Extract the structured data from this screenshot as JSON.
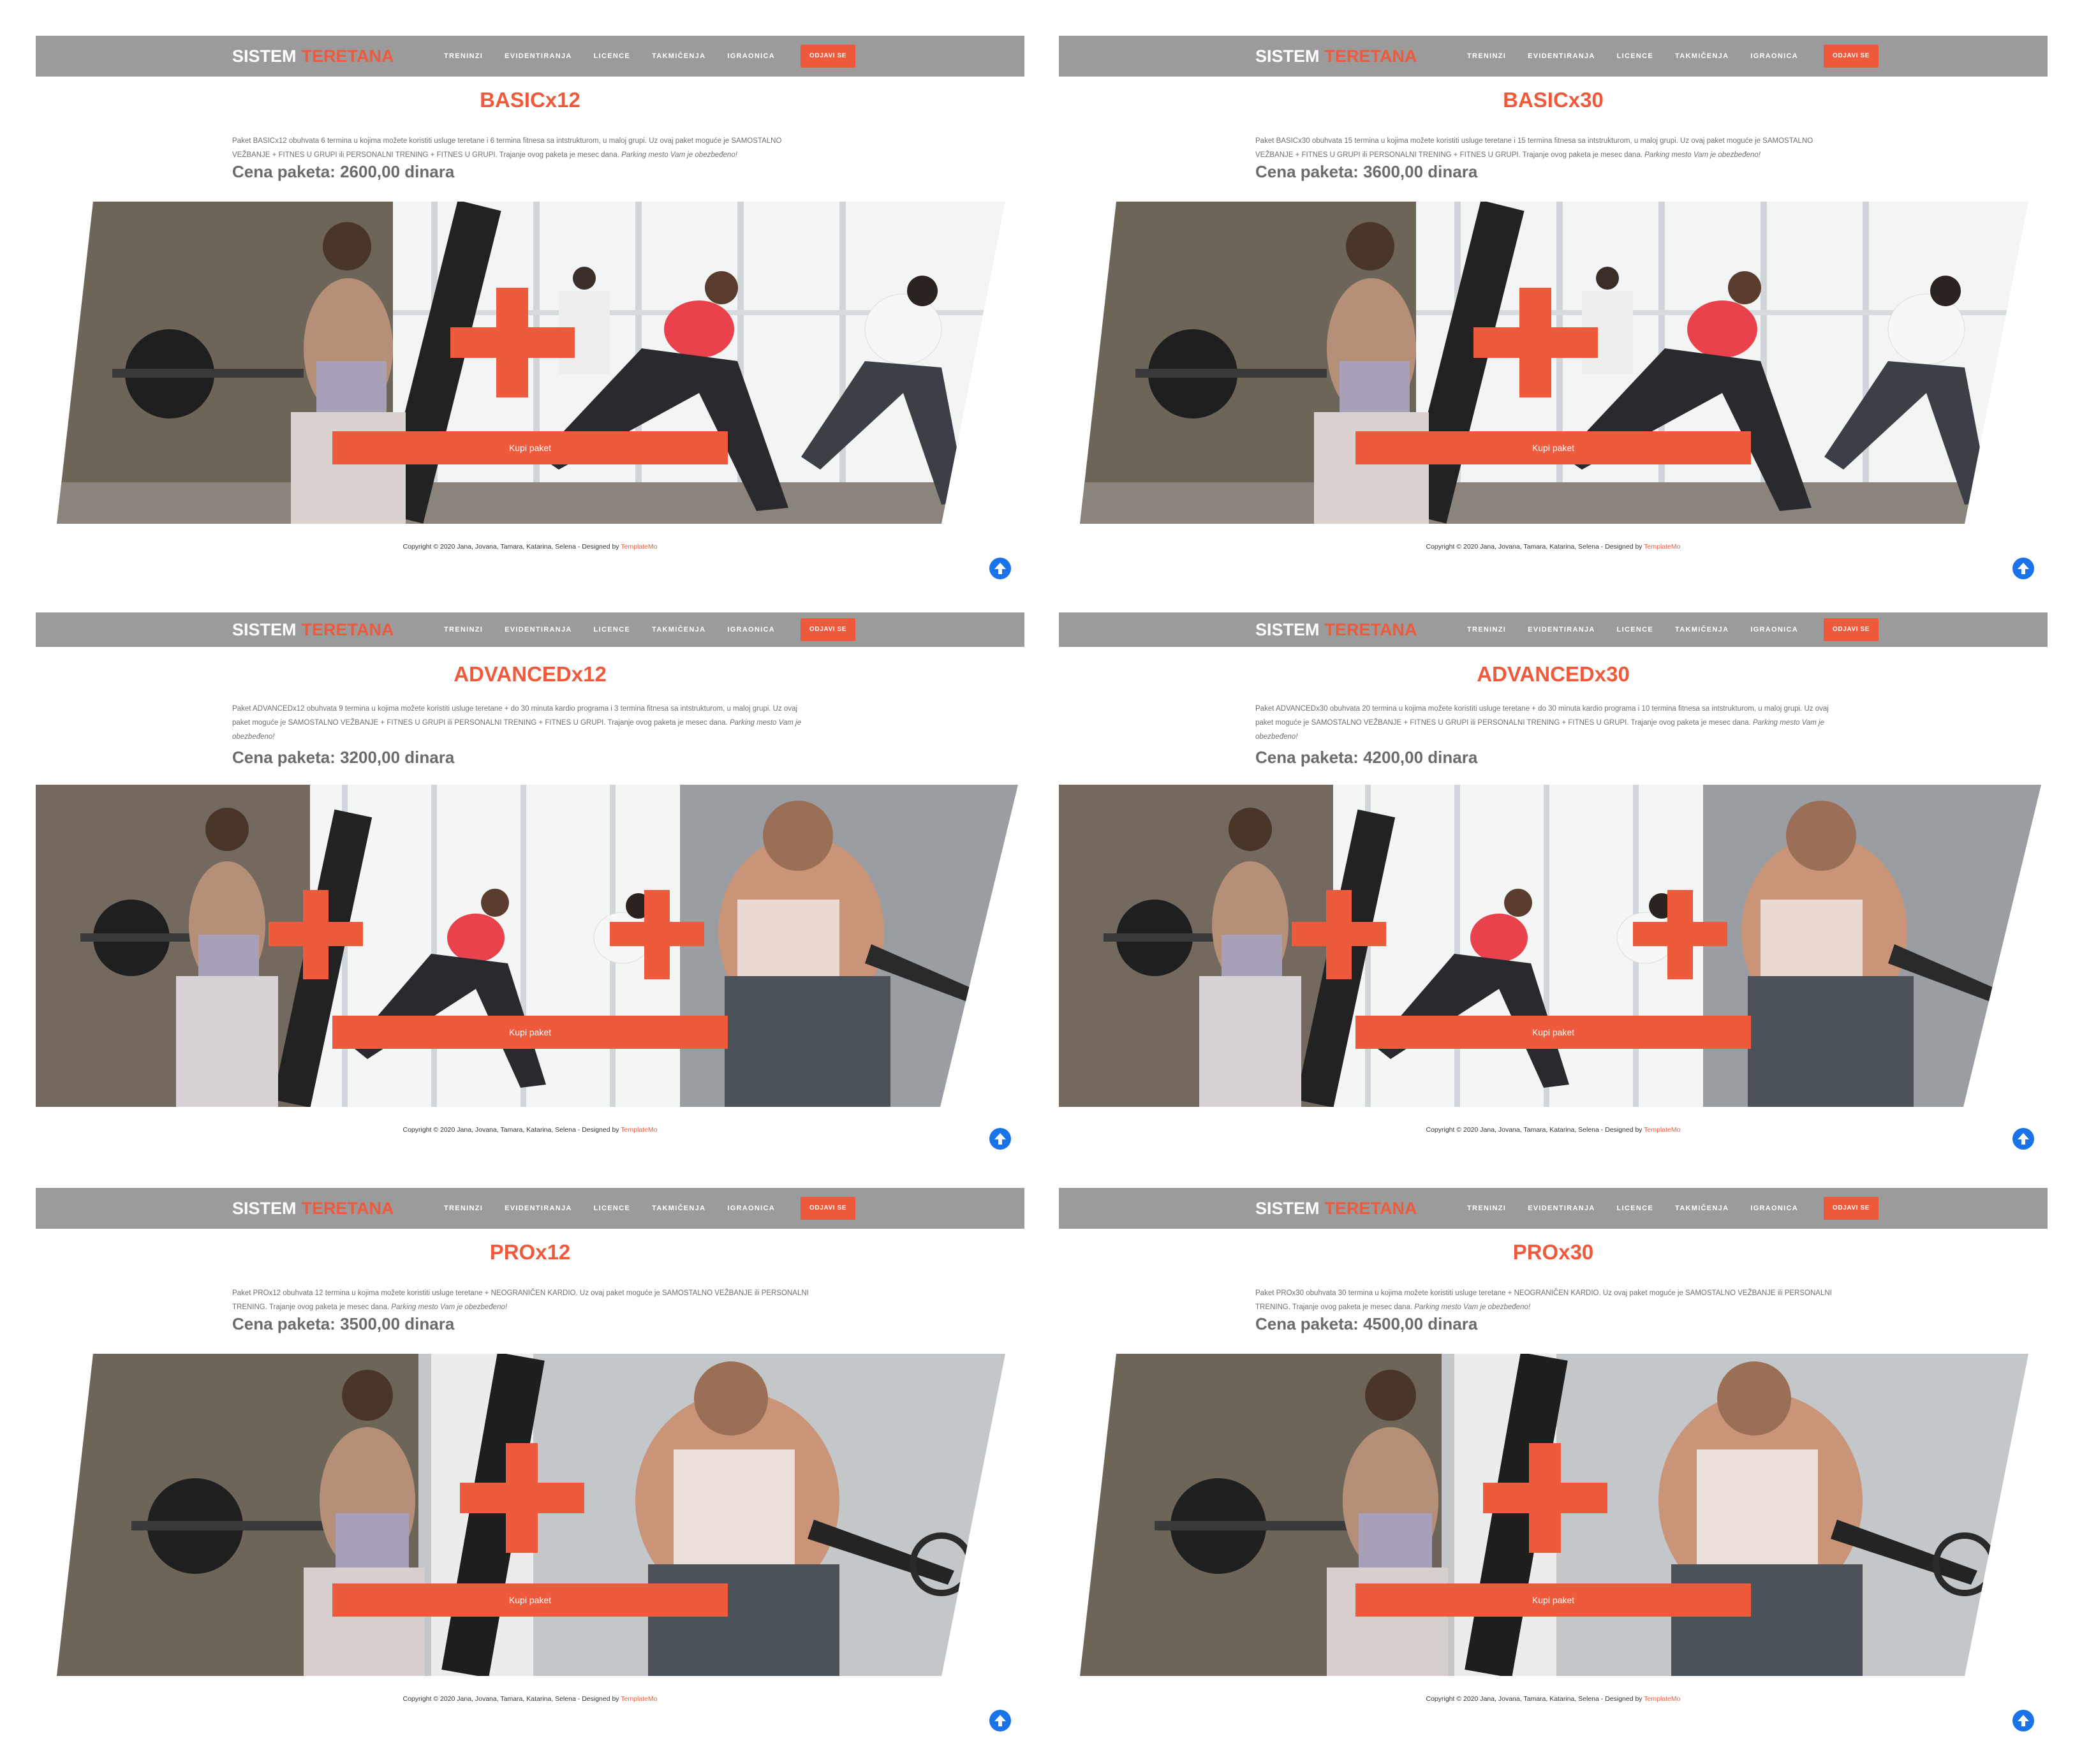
{
  "brand": {
    "part1": "SISTEM",
    "part2": "TERETANA"
  },
  "nav": {
    "items": [
      "TRENINZI",
      "EVIDENTIRANJA",
      "LICENCE",
      "TAKMIČENJA",
      "IGRAONICA"
    ],
    "logout": "ODJAVI SE"
  },
  "cta_label": "Kupi paket",
  "footer": {
    "copyright": "Copyright © 2020 Jana, Jovana, Tamara, Katarina, Selena - Designed by",
    "designer": "TemplateMo"
  },
  "colors": {
    "accent": "#f05a3c",
    "nav_bg": "#9b9b9b",
    "totop": "#1a73e8"
  },
  "panels": [
    {
      "title": "BASICx12",
      "desc_main": "Paket BASICx12 obuhvata 6 termina u kojima možete koristiti usluge teretane i 6 termina fitnesa sa intstrukturom, u maloj grupi. Uz ovaj paket moguće je SAMOSTALNO VEŽBANJE + FITNES U GRUPI ili PERSONALNI TRENING + FITNES U GRUPI. Trajanje ovog paketa je mesec dana.",
      "desc_note": "Parking mesto Vam je obezbeđeno!",
      "price": "Cena paketa: 2600,00 dinara",
      "image": "gym-and-yoga"
    },
    {
      "title": "BASICx30",
      "desc_main": "Paket BASICx30 obuhvata 15 termina u kojima možete koristiti usluge teretane i 15 termina fitnesa sa intstrukturom, u maloj grupi. Uz ovaj paket moguće je SAMOSTALNO VEŽBANJE + FITNES U GRUPI ili PERSONALNI TRENING + FITNES U GRUPI. Trajanje ovog paketa je mesec dana.",
      "desc_note": "Parking mesto Vam je obezbeđeno!",
      "price": "Cena paketa: 3600,00 dinara",
      "image": "gym-and-yoga"
    },
    {
      "title": "ADVANCEDx12",
      "desc_main": "Paket ADVANCEDx12 obuhvata 9 termina u kojima možete koristiti usluge teretane + do 30 minuta kardio programa i 3 termina fitnesa sa intstrukturom, u maloj grupi. Uz ovaj paket moguće je SAMOSTALNO VEŽBANJE + FITNES U GRUPI ili PERSONALNI TRENING + FITNES U GRUPI. Trajanje ovog paketa je mesec dana.",
      "desc_note": "Parking mesto Vam je obezbeđeno!",
      "price": "Cena paketa: 3200,00 dinara",
      "image": "gym-yoga-and-cardio"
    },
    {
      "title": "ADVANCEDx30",
      "desc_main": "Paket ADVANCEDx30 obuhvata 20 termina u kojima možete koristiti usluge teretane + do 30 minuta kardio programa i 10 termina fitnesa sa intstrukturom, u maloj grupi. Uz ovaj paket moguće je SAMOSTALNO VEŽBANJE + FITNES U GRUPI ili PERSONALNI TRENING + FITNES U GRUPI. Trajanje ovog paketa je mesec dana.",
      "desc_note": "Parking mesto Vam je obezbeđeno!",
      "price": "Cena paketa: 4200,00 dinara",
      "image": "gym-yoga-and-cardio"
    },
    {
      "title": "PROx12",
      "desc_main": "Paket PROx12 obuhvata 12 termina u kojima možete koristiti usluge teretane + NEOGRANIČEN KARDIO. Uz ovaj paket moguće je SAMOSTALNO VEŽBANJE ili PERSONALNI TRENING. Trajanje ovog paketa je mesec dana.",
      "desc_note": "Parking mesto Vam je obezbeđeno!",
      "price": "Cena paketa: 3500,00 dinara",
      "image": "gym-and-cardio"
    },
    {
      "title": "PROx30",
      "desc_main": "Paket PROx30 obuhvata 30 termina u kojima možete koristiti usluge teretane + NEOGRANIČEN KARDIO. Uz ovaj paket moguće je SAMOSTALNO VEŽBANJE ili PERSONALNI TRENING. Trajanje ovog paketa je mesec dana.",
      "desc_note": "Parking mesto Vam je obezbeđeno!",
      "price": "Cena paketa: 4500,00 dinara",
      "image": "gym-and-cardio"
    }
  ]
}
